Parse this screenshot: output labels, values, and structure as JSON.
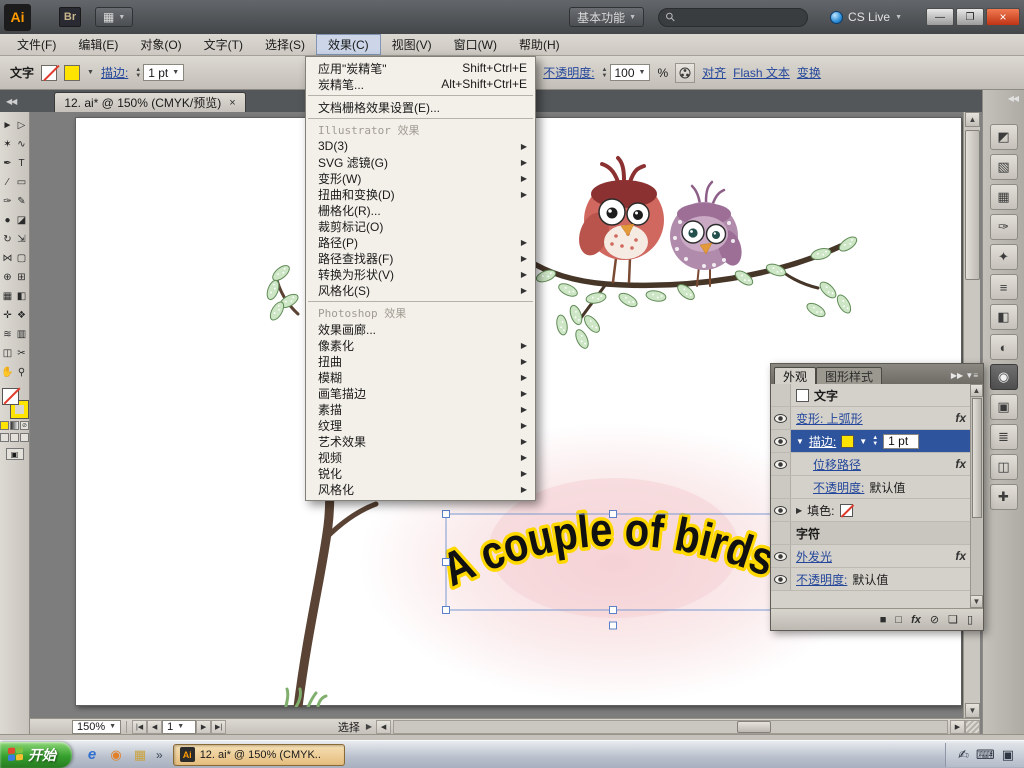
{
  "titlebar": {
    "app_logo": "Ai",
    "bridge_logo": "Br",
    "workspace_button": "基本功能",
    "cs_live_label": "CS Live"
  },
  "menubar": {
    "items": [
      "文件(F)",
      "编辑(E)",
      "对象(O)",
      "文字(T)",
      "选择(S)",
      "效果(C)",
      "视图(V)",
      "窗口(W)",
      "帮助(H)"
    ]
  },
  "effect_menu": {
    "items_top": [
      {
        "label": "应用\"炭精笔\"",
        "shortcut": "Shift+Ctrl+E"
      },
      {
        "label": "炭精笔...",
        "shortcut": "Alt+Shift+Ctrl+E"
      }
    ],
    "doc_raster": "文档栅格效果设置(E)...",
    "illustrator_header": "Illustrator 效果",
    "illustrator_items": [
      {
        "label": "3D(3)",
        "arrow": "▶"
      },
      {
        "label": "SVG 滤镜(G)",
        "arrow": "▶"
      },
      {
        "label": "变形(W)",
        "arrow": "▶"
      },
      {
        "label": "扭曲和变换(D)",
        "arrow": "▶"
      },
      {
        "label": "栅格化(R)...",
        "arrow": ""
      },
      {
        "label": "裁剪标记(O)",
        "arrow": ""
      },
      {
        "label": "路径(P)",
        "arrow": "▶"
      },
      {
        "label": "路径查找器(F)",
        "arrow": "▶"
      },
      {
        "label": "转换为形状(V)",
        "arrow": "▶"
      },
      {
        "label": "风格化(S)",
        "arrow": "▶"
      }
    ],
    "photoshop_header": "Photoshop 效果",
    "photoshop_items": [
      {
        "label": "效果画廊...",
        "arrow": ""
      },
      {
        "label": "像素化",
        "arrow": "▶"
      },
      {
        "label": "扭曲",
        "arrow": "▶"
      },
      {
        "label": "模糊",
        "arrow": "▶"
      },
      {
        "label": "画笔描边",
        "arrow": "▶"
      },
      {
        "label": "素描",
        "arrow": "▶"
      },
      {
        "label": "纹理",
        "arrow": "▶"
      },
      {
        "label": "艺术效果",
        "arrow": "▶"
      },
      {
        "label": "视频",
        "arrow": "▶"
      },
      {
        "label": "锐化",
        "arrow": "▶"
      },
      {
        "label": "风格化",
        "arrow": "▶"
      }
    ]
  },
  "control_bar": {
    "context_label": "文字",
    "stroke_label": "描边:",
    "stroke_value": "1 pt",
    "opacity_label": "不透明度:",
    "opacity_value": "100",
    "opacity_unit": "%",
    "align_label": "对齐",
    "flash_text_label": "Flash 文本",
    "transform_label": "变换"
  },
  "document_tab": {
    "title": "12. ai* @ 150% (CMYK/预览)"
  },
  "toolbox": {
    "tools": [
      {
        "name": "selection",
        "glyph": "►"
      },
      {
        "name": "direct-selection",
        "glyph": "▷"
      },
      {
        "name": "magic-wand",
        "glyph": "✶"
      },
      {
        "name": "lasso",
        "glyph": "∿"
      },
      {
        "name": "pen",
        "glyph": "✒"
      },
      {
        "name": "type",
        "glyph": "T"
      },
      {
        "name": "line-segment",
        "glyph": "∕"
      },
      {
        "name": "rectangle",
        "glyph": "▭"
      },
      {
        "name": "paintbrush",
        "glyph": "✑"
      },
      {
        "name": "pencil",
        "glyph": "✎"
      },
      {
        "name": "blob-brush",
        "glyph": "●"
      },
      {
        "name": "eraser",
        "glyph": "◪"
      },
      {
        "name": "rotate",
        "glyph": "↻"
      },
      {
        "name": "scale",
        "glyph": "⇲"
      },
      {
        "name": "width",
        "glyph": "⋈"
      },
      {
        "name": "free-transform",
        "glyph": "▢"
      },
      {
        "name": "shape-builder",
        "glyph": "⊕"
      },
      {
        "name": "perspective-grid",
        "glyph": "⊞"
      },
      {
        "name": "mesh",
        "glyph": "▦"
      },
      {
        "name": "gradient",
        "glyph": "◧"
      },
      {
        "name": "eyedropper",
        "glyph": "✛"
      },
      {
        "name": "blend",
        "glyph": "❖"
      },
      {
        "name": "symbol-sprayer",
        "glyph": "≋"
      },
      {
        "name": "column-graph",
        "glyph": "▥"
      },
      {
        "name": "artboard",
        "glyph": "◫"
      },
      {
        "name": "slice",
        "glyph": "✂"
      },
      {
        "name": "hand",
        "glyph": "✋"
      },
      {
        "name": "zoom",
        "glyph": "⚲"
      }
    ]
  },
  "canvas": {
    "artwork_text": "A couple of birds"
  },
  "appearance_panel": {
    "tab_appearance": "外观",
    "tab_graphic_styles": "图形样式",
    "row_type": "文字",
    "row_warp": "变形: 上弧形",
    "row_stroke_label": "描边:",
    "row_stroke_value": "1 pt",
    "row_offset_path": "位移路径",
    "row_opacity_label": "不透明度:",
    "row_opacity_value": "默认值",
    "row_fill_label": "填色:",
    "row_characters": "字符",
    "row_outer_glow": "外发光",
    "row_opacity2_label": "不透明度:",
    "row_opacity2_value": "默认值"
  },
  "dock": {
    "panels": [
      {
        "name": "color",
        "glyph": "◩"
      },
      {
        "name": "color-guide",
        "glyph": "▧"
      },
      {
        "name": "swatches",
        "glyph": "▦"
      },
      {
        "name": "brushes",
        "glyph": "✑"
      },
      {
        "name": "symbols",
        "glyph": "✦"
      },
      {
        "name": "stroke",
        "glyph": "≡"
      },
      {
        "name": "gradient",
        "glyph": "◧"
      },
      {
        "name": "transparency",
        "glyph": "◐"
      },
      {
        "name": "appearance",
        "glyph": "◉"
      },
      {
        "name": "graphic-styles",
        "glyph": "▣"
      },
      {
        "name": "layers",
        "glyph": "≣"
      },
      {
        "name": "artboards",
        "glyph": "◫"
      },
      {
        "name": "navigator",
        "glyph": "✚"
      }
    ]
  },
  "status_bar": {
    "zoom": "150%",
    "artboard_number": "1",
    "status_text": "选择"
  },
  "taskbar": {
    "start_label": "开始",
    "app_button_label": "12. ai* @ 150% (CMYK.."
  },
  "icons": {
    "arrange": "▦",
    "dropdown_arrow": "▼",
    "search": "⚲",
    "minimize": "—",
    "restore": "❐",
    "close": "×",
    "tab_close": "×",
    "collapse_left": "◀◀",
    "collapse_right": "◀◀",
    "spinner_up": "▲",
    "spinner_down": "▼",
    "swatch_arrow": "▼",
    "scroll_up": "▲",
    "scroll_down": "▼",
    "scroll_left": "◀",
    "scroll_right": "▶",
    "nav_first": "|◀",
    "nav_prev": "◀",
    "nav_next": "▶",
    "nav_last": "▶|",
    "status_popup": "▶",
    "panel_expand": "▶▶",
    "panel_menu": "▼≡",
    "fx": "fx",
    "expand_open": "▼",
    "expand_closed": "▶",
    "add_stroke": "■",
    "add_fill": "□",
    "add_effect": "fx",
    "clear_appearance": "⊘",
    "duplicate_item": "❏",
    "delete_item": "▯",
    "overflow": "»",
    "ie": "e",
    "quick2": "◉",
    "quick3": "▦",
    "tray_keyboard": "⌨",
    "tray_pen": "✍",
    "tray_monitor": "▣"
  }
}
